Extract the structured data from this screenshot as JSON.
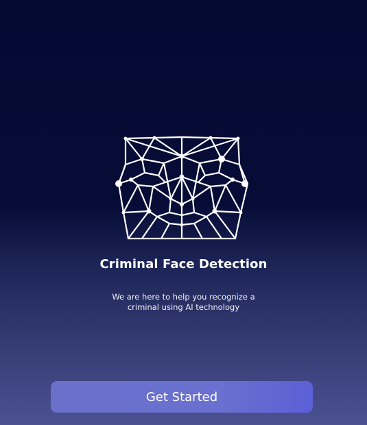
{
  "onboarding": {
    "logo_icon": "face-mesh-icon",
    "title": "Criminal Face Detection",
    "subtitle": "We are here to help you recognize a criminal using AI technology",
    "cta_label": "Get Started"
  },
  "colors": {
    "background_top": "#050a33",
    "background_bottom": "#4c5192",
    "button": "#6a70cf",
    "text": "#ffffff"
  }
}
